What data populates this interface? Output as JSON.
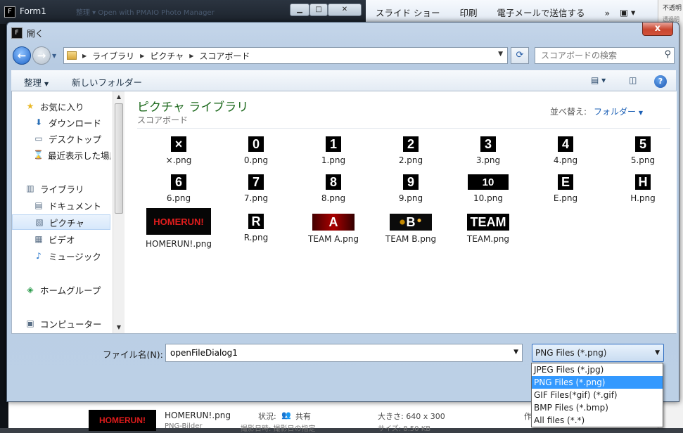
{
  "background": {
    "form1": {
      "title": "Form1",
      "faded_text": "整理 ▾ Open with PMAIO Photo Manager"
    },
    "photo_viewer": {
      "menu": [
        "スライド ショー",
        "印刷",
        "電子メールで送信する",
        "»"
      ]
    },
    "right_panel": {
      "line1": "不透明",
      "line2": "透過明"
    },
    "details": {
      "thumb_text": "HOMERUN!",
      "filename": "HOMERUN!.png",
      "status_label": "状況:",
      "status_value": "共有",
      "size_label": "大きさ: 640 x 300",
      "creator_label": "作",
      "sub_type": "PNG-Bilder",
      "sub_date": "撮影日時: 撮影日の指定",
      "sub_size": "サイズ: 8.50 KB"
    }
  },
  "dialog": {
    "title": "開く",
    "close_label": "x",
    "address": {
      "crumbs": [
        "ライブラリ",
        "ピクチャ",
        "スコアボード"
      ]
    },
    "search_placeholder": "スコアボードの検索",
    "toolbar": {
      "organize": "整理",
      "new_folder": "新しいフォルダー"
    },
    "nav": [
      {
        "label": "お気に入り",
        "icon": "star-icon"
      },
      {
        "label": "ダウンロード",
        "icon": "download-folder-icon"
      },
      {
        "label": "デスクトップ",
        "icon": "desktop-icon"
      },
      {
        "label": "最近表示した場所",
        "icon": "recent-places-icon"
      },
      {
        "label": "ライブラリ",
        "icon": "library-icon"
      },
      {
        "label": "ドキュメント",
        "icon": "documents-icon"
      },
      {
        "label": "ピクチャ",
        "icon": "pictures-icon",
        "selected": true
      },
      {
        "label": "ビデオ",
        "icon": "video-icon"
      },
      {
        "label": "ミュージック",
        "icon": "music-icon"
      },
      {
        "label": "ホームグループ",
        "icon": "homegroup-icon"
      },
      {
        "label": "コンピューター",
        "icon": "computer-icon"
      }
    ],
    "library": {
      "title": "ピクチャ ライブラリ",
      "subtitle": "スコアボード",
      "sort_label": "並べ替え:",
      "sort_value": "フォルダー"
    },
    "files": [
      {
        "thumb": "×",
        "name": "×.png",
        "kind": "sq"
      },
      {
        "thumb": "0",
        "name": "0.png",
        "kind": "sq"
      },
      {
        "thumb": "1",
        "name": "1.png",
        "kind": "sq"
      },
      {
        "thumb": "2",
        "name": "2.png",
        "kind": "sq"
      },
      {
        "thumb": "3",
        "name": "3.png",
        "kind": "sq"
      },
      {
        "thumb": "4",
        "name": "4.png",
        "kind": "sq"
      },
      {
        "thumb": "5",
        "name": "5.png",
        "kind": "sq"
      },
      {
        "thumb": "6",
        "name": "6.png",
        "kind": "sq"
      },
      {
        "thumb": "7",
        "name": "7.png",
        "kind": "sq"
      },
      {
        "thumb": "8",
        "name": "8.png",
        "kind": "sq"
      },
      {
        "thumb": "9",
        "name": "9.png",
        "kind": "sq"
      },
      {
        "thumb": "10",
        "name": "10.png",
        "kind": "wide"
      },
      {
        "thumb": "E",
        "name": "E.png",
        "kind": "sq"
      },
      {
        "thumb": "H",
        "name": "H.png",
        "kind": "sq"
      },
      {
        "thumb": "HOMERUN!",
        "name": "HOMERUN!.png",
        "kind": "banner"
      },
      {
        "thumb": "R",
        "name": "R.png",
        "kind": "sq"
      },
      {
        "thumb": "A",
        "name": "TEAM A.png",
        "kind": "teama"
      },
      {
        "thumb": "B",
        "name": "TEAM B.png",
        "kind": "spark"
      },
      {
        "thumb": "TEAM",
        "name": "TEAM.png",
        "kind": "team"
      }
    ],
    "filename_label": "ファイル名(N):",
    "filename_value": "openFileDialog1",
    "filter_selected": "PNG Files (*.png)",
    "filter_options": [
      "JPEG Files (*.jpg)",
      "PNG Files (*.png)",
      "GIF Files(*gif) (*.gif)",
      "BMP Files (*.bmp)",
      "All files (*.*)"
    ],
    "filter_selected_index": 1
  }
}
